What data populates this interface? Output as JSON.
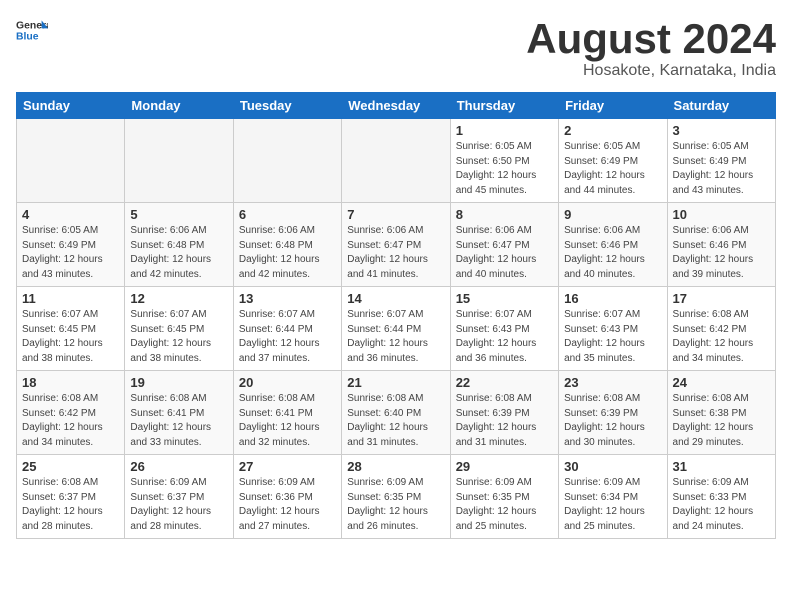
{
  "header": {
    "logo": {
      "general": "General",
      "blue": "Blue"
    },
    "title": "August 2024",
    "location": "Hosakote, Karnataka, India"
  },
  "weekdays": [
    "Sunday",
    "Monday",
    "Tuesday",
    "Wednesday",
    "Thursday",
    "Friday",
    "Saturday"
  ],
  "weeks": [
    [
      {
        "day": "",
        "empty": true
      },
      {
        "day": "",
        "empty": true
      },
      {
        "day": "",
        "empty": true
      },
      {
        "day": "",
        "empty": true
      },
      {
        "day": "1",
        "sunrise": "6:05 AM",
        "sunset": "6:50 PM",
        "daylight": "12 hours and 45 minutes."
      },
      {
        "day": "2",
        "sunrise": "6:05 AM",
        "sunset": "6:49 PM",
        "daylight": "12 hours and 44 minutes."
      },
      {
        "day": "3",
        "sunrise": "6:05 AM",
        "sunset": "6:49 PM",
        "daylight": "12 hours and 43 minutes."
      }
    ],
    [
      {
        "day": "4",
        "sunrise": "6:05 AM",
        "sunset": "6:49 PM",
        "daylight": "12 hours and 43 minutes."
      },
      {
        "day": "5",
        "sunrise": "6:06 AM",
        "sunset": "6:48 PM",
        "daylight": "12 hours and 42 minutes."
      },
      {
        "day": "6",
        "sunrise": "6:06 AM",
        "sunset": "6:48 PM",
        "daylight": "12 hours and 42 minutes."
      },
      {
        "day": "7",
        "sunrise": "6:06 AM",
        "sunset": "6:47 PM",
        "daylight": "12 hours and 41 minutes."
      },
      {
        "day": "8",
        "sunrise": "6:06 AM",
        "sunset": "6:47 PM",
        "daylight": "12 hours and 40 minutes."
      },
      {
        "day": "9",
        "sunrise": "6:06 AM",
        "sunset": "6:46 PM",
        "daylight": "12 hours and 40 minutes."
      },
      {
        "day": "10",
        "sunrise": "6:06 AM",
        "sunset": "6:46 PM",
        "daylight": "12 hours and 39 minutes."
      }
    ],
    [
      {
        "day": "11",
        "sunrise": "6:07 AM",
        "sunset": "6:45 PM",
        "daylight": "12 hours and 38 minutes."
      },
      {
        "day": "12",
        "sunrise": "6:07 AM",
        "sunset": "6:45 PM",
        "daylight": "12 hours and 38 minutes."
      },
      {
        "day": "13",
        "sunrise": "6:07 AM",
        "sunset": "6:44 PM",
        "daylight": "12 hours and 37 minutes."
      },
      {
        "day": "14",
        "sunrise": "6:07 AM",
        "sunset": "6:44 PM",
        "daylight": "12 hours and 36 minutes."
      },
      {
        "day": "15",
        "sunrise": "6:07 AM",
        "sunset": "6:43 PM",
        "daylight": "12 hours and 36 minutes."
      },
      {
        "day": "16",
        "sunrise": "6:07 AM",
        "sunset": "6:43 PM",
        "daylight": "12 hours and 35 minutes."
      },
      {
        "day": "17",
        "sunrise": "6:08 AM",
        "sunset": "6:42 PM",
        "daylight": "12 hours and 34 minutes."
      }
    ],
    [
      {
        "day": "18",
        "sunrise": "6:08 AM",
        "sunset": "6:42 PM",
        "daylight": "12 hours and 34 minutes."
      },
      {
        "day": "19",
        "sunrise": "6:08 AM",
        "sunset": "6:41 PM",
        "daylight": "12 hours and 33 minutes."
      },
      {
        "day": "20",
        "sunrise": "6:08 AM",
        "sunset": "6:41 PM",
        "daylight": "12 hours and 32 minutes."
      },
      {
        "day": "21",
        "sunrise": "6:08 AM",
        "sunset": "6:40 PM",
        "daylight": "12 hours and 31 minutes."
      },
      {
        "day": "22",
        "sunrise": "6:08 AM",
        "sunset": "6:39 PM",
        "daylight": "12 hours and 31 minutes."
      },
      {
        "day": "23",
        "sunrise": "6:08 AM",
        "sunset": "6:39 PM",
        "daylight": "12 hours and 30 minutes."
      },
      {
        "day": "24",
        "sunrise": "6:08 AM",
        "sunset": "6:38 PM",
        "daylight": "12 hours and 29 minutes."
      }
    ],
    [
      {
        "day": "25",
        "sunrise": "6:08 AM",
        "sunset": "6:37 PM",
        "daylight": "12 hours and 28 minutes."
      },
      {
        "day": "26",
        "sunrise": "6:09 AM",
        "sunset": "6:37 PM",
        "daylight": "12 hours and 28 minutes."
      },
      {
        "day": "27",
        "sunrise": "6:09 AM",
        "sunset": "6:36 PM",
        "daylight": "12 hours and 27 minutes."
      },
      {
        "day": "28",
        "sunrise": "6:09 AM",
        "sunset": "6:35 PM",
        "daylight": "12 hours and 26 minutes."
      },
      {
        "day": "29",
        "sunrise": "6:09 AM",
        "sunset": "6:35 PM",
        "daylight": "12 hours and 25 minutes."
      },
      {
        "day": "30",
        "sunrise": "6:09 AM",
        "sunset": "6:34 PM",
        "daylight": "12 hours and 25 minutes."
      },
      {
        "day": "31",
        "sunrise": "6:09 AM",
        "sunset": "6:33 PM",
        "daylight": "12 hours and 24 minutes."
      }
    ]
  ]
}
